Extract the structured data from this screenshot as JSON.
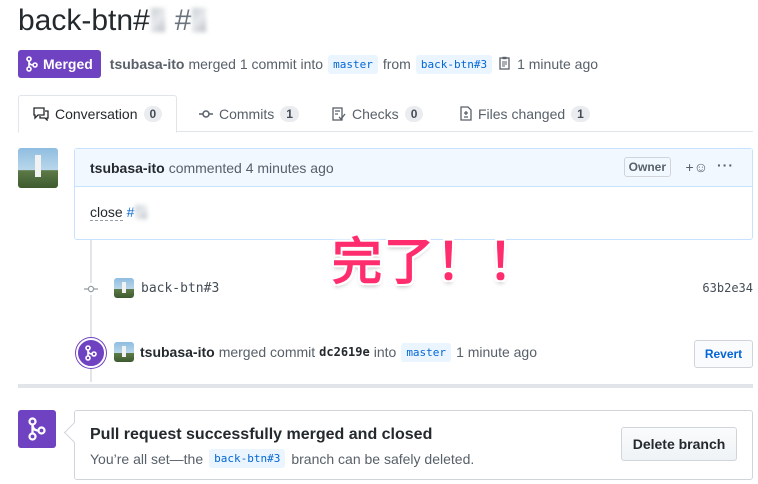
{
  "pr": {
    "title": "back-btn#",
    "number_prefix": "#"
  },
  "meta": {
    "status": "Merged",
    "author": "tsubasa-ito",
    "action": "merged 1 commit into",
    "base_branch": "master",
    "from_text": "from",
    "head_branch": "back-btn#3",
    "time": "1 minute ago"
  },
  "tabs": [
    {
      "label": "Conversation",
      "count": "0",
      "icon": "comment-discussion-icon"
    },
    {
      "label": "Commits",
      "count": "1",
      "icon": "git-commit-icon"
    },
    {
      "label": "Checks",
      "count": "0",
      "icon": "checklist-icon"
    },
    {
      "label": "Files changed",
      "count": "1",
      "icon": "file-diff-icon"
    }
  ],
  "comment": {
    "author": "tsubasa-ito",
    "action": "commented 4 minutes ago",
    "badge": "Owner",
    "body_text": "close",
    "body_link": "#"
  },
  "commit": {
    "message": "back-btn#3",
    "sha": "63b2e34"
  },
  "overlay_text": "完了！！",
  "merge_event": {
    "author": "tsubasa-ito",
    "action": "merged commit",
    "sha": "dc2619e",
    "into": "into",
    "branch": "master",
    "time": "1 minute ago",
    "revert_label": "Revert"
  },
  "merge_box": {
    "title": "Pull request successfully merged and closed",
    "text_before": "You’re all set—the",
    "branch": "back-btn#3",
    "text_after": "branch can be safely deleted.",
    "delete_label": "Delete branch"
  },
  "colors": {
    "merged_purple": "#6f42c1",
    "link_blue": "#0366d6",
    "overlay_pink": "#ff2d6e"
  }
}
